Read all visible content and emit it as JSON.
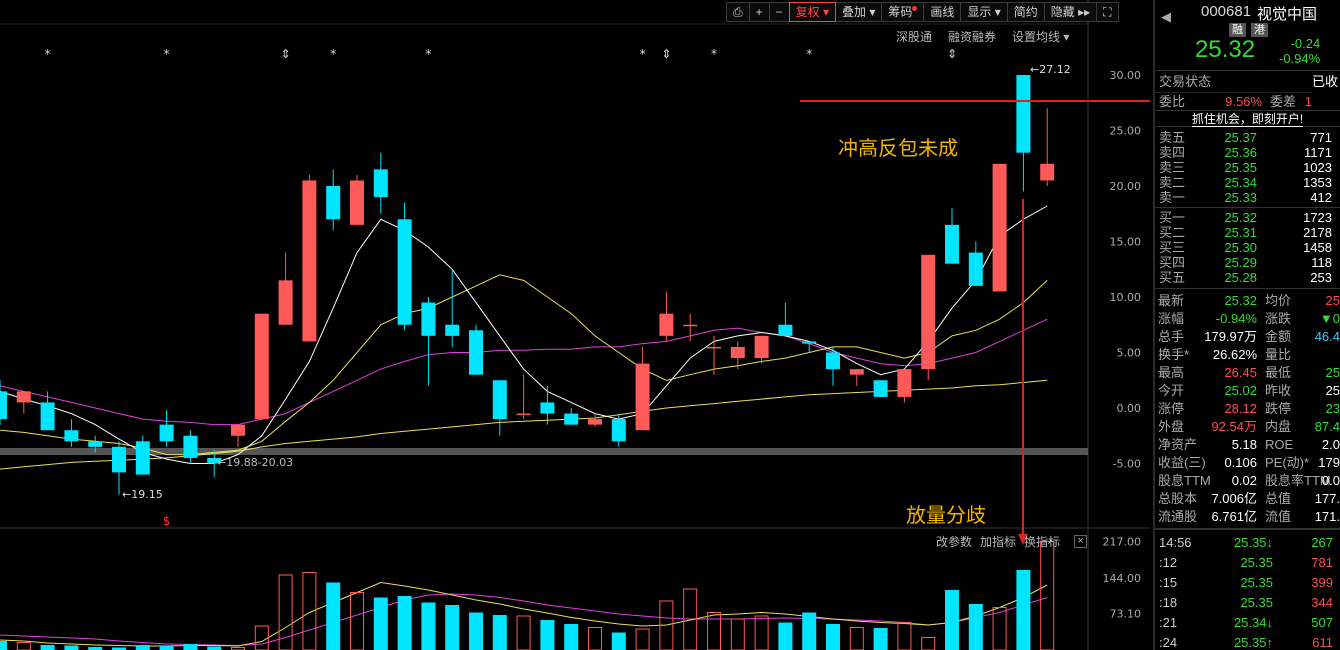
{
  "toolbar": {
    "buttons": [
      "⎙",
      "+",
      "−",
      "复权 ▾",
      "叠加 ▾",
      "筹码",
      "画线",
      "显示 ▾",
      "简约",
      "隐藏 ▸▸",
      "⛶"
    ],
    "sub": [
      "深股通",
      "融资融券",
      "设置均线 ▾"
    ],
    "indicator": [
      "改参数",
      "加指标",
      "换指标"
    ]
  },
  "annotations": {
    "top": "冲高反包未成",
    "bottom": "放量分歧"
  },
  "chart_data": {
    "type": "candlestick",
    "y_axis": {
      "ticks": [
        "30.00",
        "25.00",
        "20.00",
        "15.00",
        "10.00",
        "5.00",
        "0.00",
        "-5.00"
      ],
      "unit": "percent"
    },
    "volume_axis": {
      "ticks": [
        "217.00",
        "144.00",
        "73.10"
      ]
    },
    "price_labels": {
      "high": "27.12",
      "low": "19.15",
      "range": "19.88-20.03"
    },
    "candles": [
      {
        "o": 1.5,
        "h": 2.5,
        "l": -1.5,
        "c": -1.0
      },
      {
        "o": 0.5,
        "h": 1.5,
        "l": -0.5,
        "c": 1.5
      },
      {
        "o": 0.5,
        "h": 1.5,
        "l": -2.0,
        "c": -2.0
      },
      {
        "o": -2.0,
        "h": -1.0,
        "l": -3.5,
        "c": -3.0
      },
      {
        "o": -3.0,
        "h": -2.5,
        "l": -4.0,
        "c": -3.5
      },
      {
        "o": -3.5,
        "h": -3.0,
        "l": -7.8,
        "c": -5.8
      },
      {
        "o": -3.0,
        "h": -2.5,
        "l": -6.0,
        "c": -6.0
      },
      {
        "o": -1.5,
        "h": -0.2,
        "l": -3.5,
        "c": -3.0
      },
      {
        "o": -2.5,
        "h": -2.0,
        "l": -5.0,
        "c": -4.5
      },
      {
        "o": -4.5,
        "h": -3.8,
        "l": -6.2,
        "c": -5.0
      },
      {
        "o": -2.5,
        "h": -1.5,
        "l": -3.5,
        "c": -1.5
      },
      {
        "o": -1.0,
        "h": 8.5,
        "l": -1.0,
        "c": 8.5
      },
      {
        "o": 7.5,
        "h": 14.0,
        "l": 7.5,
        "c": 11.5
      },
      {
        "o": 6.0,
        "h": 21.0,
        "l": 6.0,
        "c": 20.5
      },
      {
        "o": 20.0,
        "h": 21.5,
        "l": 16.0,
        "c": 17.0
      },
      {
        "o": 16.5,
        "h": 21.0,
        "l": 16.5,
        "c": 20.5
      },
      {
        "o": 21.5,
        "h": 23.0,
        "l": 17.5,
        "c": 19.0
      },
      {
        "o": 17.0,
        "h": 18.5,
        "l": 7.0,
        "c": 7.5
      },
      {
        "o": 9.5,
        "h": 10.0,
        "l": 2.0,
        "c": 6.5
      },
      {
        "o": 7.5,
        "h": 12.5,
        "l": 5.5,
        "c": 6.5
      },
      {
        "o": 7.0,
        "h": 7.5,
        "l": 3.0,
        "c": 3.0
      },
      {
        "o": 2.5,
        "h": 2.5,
        "l": -2.5,
        "c": -1.0
      },
      {
        "o": -0.5,
        "h": 3.0,
        "l": -1.0,
        "c": -0.5
      },
      {
        "o": 0.5,
        "h": 2.0,
        "l": -1.5,
        "c": -0.5
      },
      {
        "o": -0.5,
        "h": 0.0,
        "l": -1.5,
        "c": -1.5
      },
      {
        "o": -1.5,
        "h": -0.5,
        "l": -1.7,
        "c": -1.0
      },
      {
        "o": -1.0,
        "h": -0.5,
        "l": -3.5,
        "c": -3.0
      },
      {
        "o": -2.0,
        "h": 5.5,
        "l": -2.0,
        "c": 4.0
      },
      {
        "o": 6.5,
        "h": 10.5,
        "l": 6.0,
        "c": 8.5
      },
      {
        "o": 7.5,
        "h": 8.5,
        "l": 6.0,
        "c": 7.5
      },
      {
        "o": 5.5,
        "h": 6.5,
        "l": 3.0,
        "c": 5.5
      },
      {
        "o": 4.5,
        "h": 6.0,
        "l": 3.5,
        "c": 5.5
      },
      {
        "o": 4.5,
        "h": 6.5,
        "l": 4.0,
        "c": 6.5
      },
      {
        "o": 7.5,
        "h": 9.5,
        "l": 6.5,
        "c": 6.5
      },
      {
        "o": 6.0,
        "h": 6.0,
        "l": 5.0,
        "c": 5.8
      },
      {
        "o": 5.0,
        "h": 5.5,
        "l": 2.0,
        "c": 3.5
      },
      {
        "o": 3.0,
        "h": 3.5,
        "l": 2.0,
        "c": 3.5
      },
      {
        "o": 2.5,
        "h": 2.5,
        "l": 1.0,
        "c": 1.0
      },
      {
        "o": 1.0,
        "h": 3.5,
        "l": 0.5,
        "c": 3.5
      },
      {
        "o": 3.5,
        "h": 13.8,
        "l": 2.5,
        "c": 13.8
      },
      {
        "o": 16.5,
        "h": 18.0,
        "l": 13.0,
        "c": 13.0
      },
      {
        "o": 14.0,
        "h": 15.0,
        "l": 11.0,
        "c": 11.0
      },
      {
        "o": 10.5,
        "h": 22.0,
        "l": 10.5,
        "c": 22.0
      },
      {
        "o": 30.0,
        "h": 30.0,
        "l": 19.5,
        "c": 23.0
      },
      {
        "o": 20.5,
        "h": 27.0,
        "l": 20.0,
        "c": 22.0
      }
    ],
    "ma5": [
      1.5,
      0.8,
      0.2,
      -0.5,
      -1.5,
      -2.8,
      -4.0,
      -4.6,
      -5.0,
      -5.0,
      -4.2,
      -2.5,
      0.8,
      4.2,
      9.0,
      14.0,
      17.0,
      16.0,
      14.5,
      12.5,
      9.5,
      6.5,
      3.5,
      1.5,
      0.5,
      -0.5,
      -1.0,
      -0.5,
      2.0,
      4.5,
      6.0,
      6.5,
      6.8,
      6.5,
      6.0,
      5.2,
      4.0,
      3.0,
      3.5,
      6.0,
      9.0,
      11.5,
      15.5,
      17.0,
      18.2
    ],
    "ma10": [
      -2.0,
      -2.2,
      -2.5,
      -2.8,
      -3.0,
      -3.2,
      -3.6,
      -4.2,
      -4.2,
      -4.0,
      -3.8,
      -3.0,
      -1.2,
      0.5,
      2.5,
      5.0,
      7.5,
      8.5,
      9.0,
      10.0,
      11.0,
      12.0,
      11.5,
      10.0,
      8.5,
      6.5,
      5.0,
      3.5,
      2.5,
      3.0,
      3.5,
      3.8,
      4.2,
      4.5,
      5.0,
      5.5,
      5.5,
      5.0,
      4.5,
      5.0,
      6.5,
      7.0,
      8.0,
      9.5,
      11.5
    ],
    "ma20": [
      2.0,
      1.5,
      1.0,
      0.5,
      0.0,
      -0.5,
      -1.0,
      -1.2,
      -1.3,
      -1.5,
      -1.5,
      -1.0,
      -0.5,
      0.5,
      1.5,
      2.5,
      3.5,
      4.2,
      4.8,
      5.0,
      5.0,
      5.2,
      5.2,
      5.3,
      5.3,
      5.5,
      5.5,
      5.8,
      6.0,
      6.5,
      7.0,
      7.2,
      6.8,
      6.5,
      5.8,
      5.0,
      4.5,
      4.0,
      3.8,
      4.0,
      4.5,
      5.0,
      6.0,
      7.0,
      8.0
    ],
    "ma60": [
      -5.5,
      -5.3,
      -5.1,
      -4.9,
      -4.8,
      -4.7,
      -4.6,
      -4.5,
      -4.3,
      -4.1,
      -3.9,
      -3.5,
      -3.2,
      -3.0,
      -2.8,
      -2.6,
      -2.3,
      -2.1,
      -1.9,
      -1.7,
      -1.5,
      -1.3,
      -1.2,
      -1.1,
      -1.0,
      -0.9,
      -0.6,
      -0.3,
      0.0,
      0.2,
      0.4,
      0.6,
      0.8,
      1.0,
      1.2,
      1.3,
      1.4,
      1.5,
      1.6,
      1.7,
      1.8,
      2.0,
      2.1,
      2.3,
      2.5
    ],
    "volumes": [
      18,
      15,
      10,
      9,
      6,
      5,
      10,
      8,
      12,
      7,
      5,
      48,
      150,
      155,
      135,
      115,
      105,
      108,
      95,
      90,
      75,
      70,
      68,
      60,
      52,
      45,
      35,
      42,
      98,
      122,
      75,
      62,
      68,
      55,
      75,
      52,
      45,
      44,
      55,
      25,
      120,
      92,
      85,
      160,
      217,
      170
    ],
    "vol_ma5": [
      20,
      18,
      14,
      12,
      10,
      9,
      8,
      8,
      9,
      9,
      8,
      17,
      45,
      75,
      95,
      115,
      135,
      128,
      120,
      110,
      100,
      92,
      82,
      74,
      65,
      58,
      52,
      48,
      50,
      60,
      70,
      72,
      75,
      72,
      67,
      62,
      58,
      55,
      53,
      50,
      55,
      68,
      85,
      105,
      130
    ],
    "vol_ma10": [
      30,
      28,
      26,
      24,
      22,
      18,
      15,
      12,
      11,
      10,
      9,
      12,
      25,
      40,
      55,
      70,
      85,
      100,
      110,
      112,
      110,
      105,
      98,
      90,
      84,
      78,
      72,
      68,
      64,
      62,
      62,
      62,
      63,
      64,
      63,
      62,
      60,
      58,
      55,
      50,
      55,
      65,
      75,
      90,
      105
    ]
  },
  "markers": {
    "top": [
      "*",
      "*",
      "⇕",
      "*",
      "*",
      "*",
      "⇕",
      "*",
      "*",
      "⇕"
    ],
    "bottom": "$"
  },
  "quote": {
    "code": "000681",
    "name": "视觉中国",
    "badge1": "融",
    "badge2": "港",
    "price": "25.32",
    "change": "-0.24",
    "change_pct": "-0.94%",
    "state_label": "交易状态",
    "state_value": "已收",
    "ratio_label": "委比",
    "ratio_value": "9.56%",
    "diff_label": "委差",
    "diff_value": "1",
    "promo": "抓住机会，即刻开户!",
    "asks": [
      {
        "label": "卖五",
        "price": "25.37",
        "vol": "771"
      },
      {
        "label": "卖四",
        "price": "25.36",
        "vol": "1171"
      },
      {
        "label": "卖三",
        "price": "25.35",
        "vol": "1023"
      },
      {
        "label": "卖二",
        "price": "25.34",
        "vol": "1353"
      },
      {
        "label": "卖一",
        "price": "25.33",
        "vol": "412"
      }
    ],
    "bids": [
      {
        "label": "买一",
        "price": "25.32",
        "vol": "1723"
      },
      {
        "label": "买二",
        "price": "25.31",
        "vol": "2178"
      },
      {
        "label": "买三",
        "price": "25.30",
        "vol": "1458"
      },
      {
        "label": "买四",
        "price": "25.29",
        "vol": "118"
      },
      {
        "label": "买五",
        "price": "25.28",
        "vol": "253"
      }
    ],
    "stats": [
      {
        "l1": "最新",
        "v1": "25.32",
        "c1": "green",
        "l2": "均价",
        "v2": "25",
        "c2": "red"
      },
      {
        "l1": "涨幅",
        "v1": "-0.94%",
        "c1": "green",
        "l2": "涨跌",
        "v2": "▼0",
        "c2": "green"
      },
      {
        "l1": "总手",
        "v1": "179.97万",
        "c1": "white",
        "l2": "金额",
        "v2": "46.4",
        "c2": "cyan"
      },
      {
        "l1": "换手*",
        "v1": "26.62%",
        "c1": "white",
        "l2": "量比",
        "v2": "",
        "c2": "white"
      },
      {
        "l1": "最高",
        "v1": "26.45",
        "c1": "red",
        "l2": "最低",
        "v2": "25",
        "c2": "green"
      },
      {
        "l1": "今开",
        "v1": "25.02",
        "c1": "green",
        "l2": "昨收",
        "v2": "25",
        "c2": "white"
      },
      {
        "l1": "涨停",
        "v1": "28.12",
        "c1": "red",
        "l2": "跌停",
        "v2": "23",
        "c2": "green"
      },
      {
        "l1": "外盘",
        "v1": "92.54万",
        "c1": "red",
        "l2": "内盘",
        "v2": "87.4",
        "c2": "green"
      },
      {
        "l1": "净资产",
        "v1": "5.18",
        "c1": "white",
        "l2": "ROE",
        "v2": "2.0",
        "c2": "white"
      },
      {
        "l1": "收益(三)",
        "v1": "0.106",
        "c1": "white",
        "l2": "PE(动)*",
        "v2": "179",
        "c2": "white"
      },
      {
        "l1": "股息TTM",
        "v1": "0.02",
        "c1": "white",
        "l2": "股息率TTM",
        "v2": "0.0",
        "c2": "white"
      },
      {
        "l1": "总股本",
        "v1": "7.006亿",
        "c1": "white",
        "l2": "总值",
        "v2": "177.",
        "c2": "white"
      },
      {
        "l1": "流通股",
        "v1": "6.761亿",
        "c1": "white",
        "l2": "流值",
        "v2": "171.",
        "c2": "white"
      }
    ],
    "ticks": [
      {
        "t": "14:56",
        "p": "25.35",
        "arrow": "↓",
        "v": "267",
        "vc": "green"
      },
      {
        "t": ":12",
        "p": "25.35",
        "arrow": "",
        "v": "781",
        "vc": "red"
      },
      {
        "t": ":15",
        "p": "25.35",
        "arrow": "",
        "v": "399",
        "vc": "red"
      },
      {
        "t": ":18",
        "p": "25.35",
        "arrow": "",
        "v": "344",
        "vc": "red"
      },
      {
        "t": ":21",
        "p": "25.34",
        "arrow": "↓",
        "v": "507",
        "vc": "green"
      },
      {
        "t": ":24",
        "p": "25.35",
        "arrow": "↑",
        "v": "611",
        "vc": "red"
      }
    ]
  },
  "colors": {
    "up": "#ff5a5a",
    "down": "#00e5ff",
    "ma5": "#ffffff",
    "ma10": "#e8e05a",
    "ma20": "#e040e0",
    "ma60": "#e8e05a",
    "annotation": "#f5b400",
    "arrow": "#e02020"
  }
}
